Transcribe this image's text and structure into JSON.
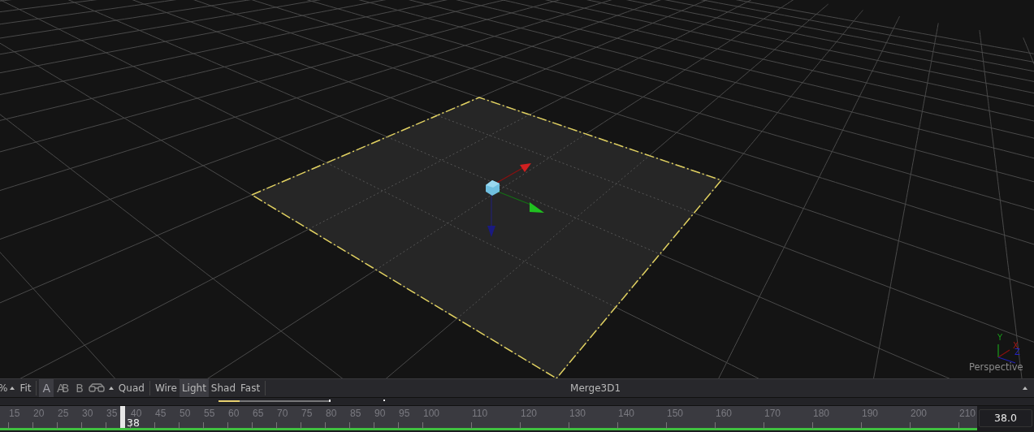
{
  "viewport": {
    "view_label": "Perspective",
    "axes": [
      "X",
      "Y",
      "Z"
    ]
  },
  "toolbar": {
    "zoom": "%",
    "fit": "Fit",
    "buffers": [
      {
        "label": "A",
        "selected": true
      },
      {
        "label": "AB",
        "selected": false
      },
      {
        "label": "B",
        "selected": false
      }
    ],
    "layout": "Quad",
    "modes": [
      {
        "label": "Wire",
        "selected": false
      },
      {
        "label": "Light",
        "selected": true
      },
      {
        "label": "Shad",
        "selected": false
      },
      {
        "label": "Fast",
        "selected": false
      }
    ],
    "node": "Merge3D1"
  },
  "timeline": {
    "ticks": [
      "15",
      "20",
      "25",
      "30",
      "35",
      "40",
      "45",
      "50",
      "55",
      "60",
      "65",
      "70",
      "75",
      "80",
      "85",
      "90",
      "95",
      "100",
      "110",
      "120",
      "130",
      "140",
      "150",
      "160",
      "170",
      "180",
      "190",
      "200",
      "210"
    ],
    "current": "38",
    "level": 0.1233,
    "frame_field": "38.0"
  }
}
